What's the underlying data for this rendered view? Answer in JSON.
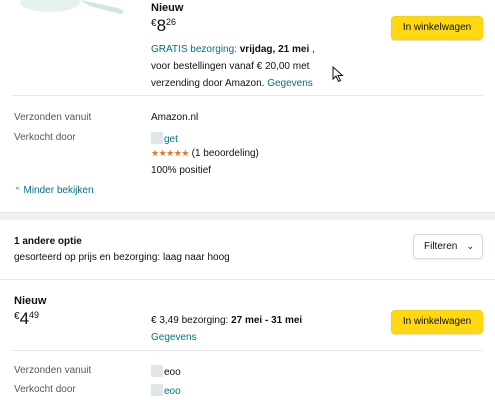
{
  "offer1": {
    "condition": "Nieuw",
    "price_currency": "€",
    "price_whole": "8",
    "price_fraction": "26",
    "delivery_free": "GRATIS bezorging:",
    "delivery_date": "vrijdag, 21 mei",
    "delivery_tail": ",",
    "delivery_line2": "voor bestellingen vanaf € 20,00 met",
    "delivery_line3": "verzending door Amazon.",
    "details_link": "Gegevens",
    "cart_button": "In winkelwagen",
    "shipped_from_label": "Verzonden vanuit",
    "shipped_from_value": "Amazon.nl",
    "sold_by_label": "Verkocht door",
    "seller_name": "get",
    "stars": "★★★★★",
    "rating_count": "(1 beoordeling)",
    "positive": "100% positief",
    "show_less": "Minder bekijken"
  },
  "options": {
    "title": "1 andere optie",
    "sort_text": "gesorteerd op prijs en bezorging: laag naar hoog",
    "filter_button": "Filteren"
  },
  "offer2": {
    "condition": "Nieuw",
    "price_currency": "€",
    "price_whole": "4",
    "price_fraction": "49",
    "delivery_cost": "€ 3,49 bezorging:",
    "delivery_date": "27 mei - 31 mei",
    "details_link": "Gegevens",
    "cart_button": "In winkelwagen",
    "shipped_from_label": "Verzonden vanuit",
    "shipped_from_value": "eoo",
    "sold_by_label": "Verkocht door",
    "seller_name": "eoo"
  },
  "colors": {
    "link": "#007185",
    "cart_button": "#ffd814",
    "stars": "#de7921",
    "section_bg": "#f0f2f2"
  }
}
